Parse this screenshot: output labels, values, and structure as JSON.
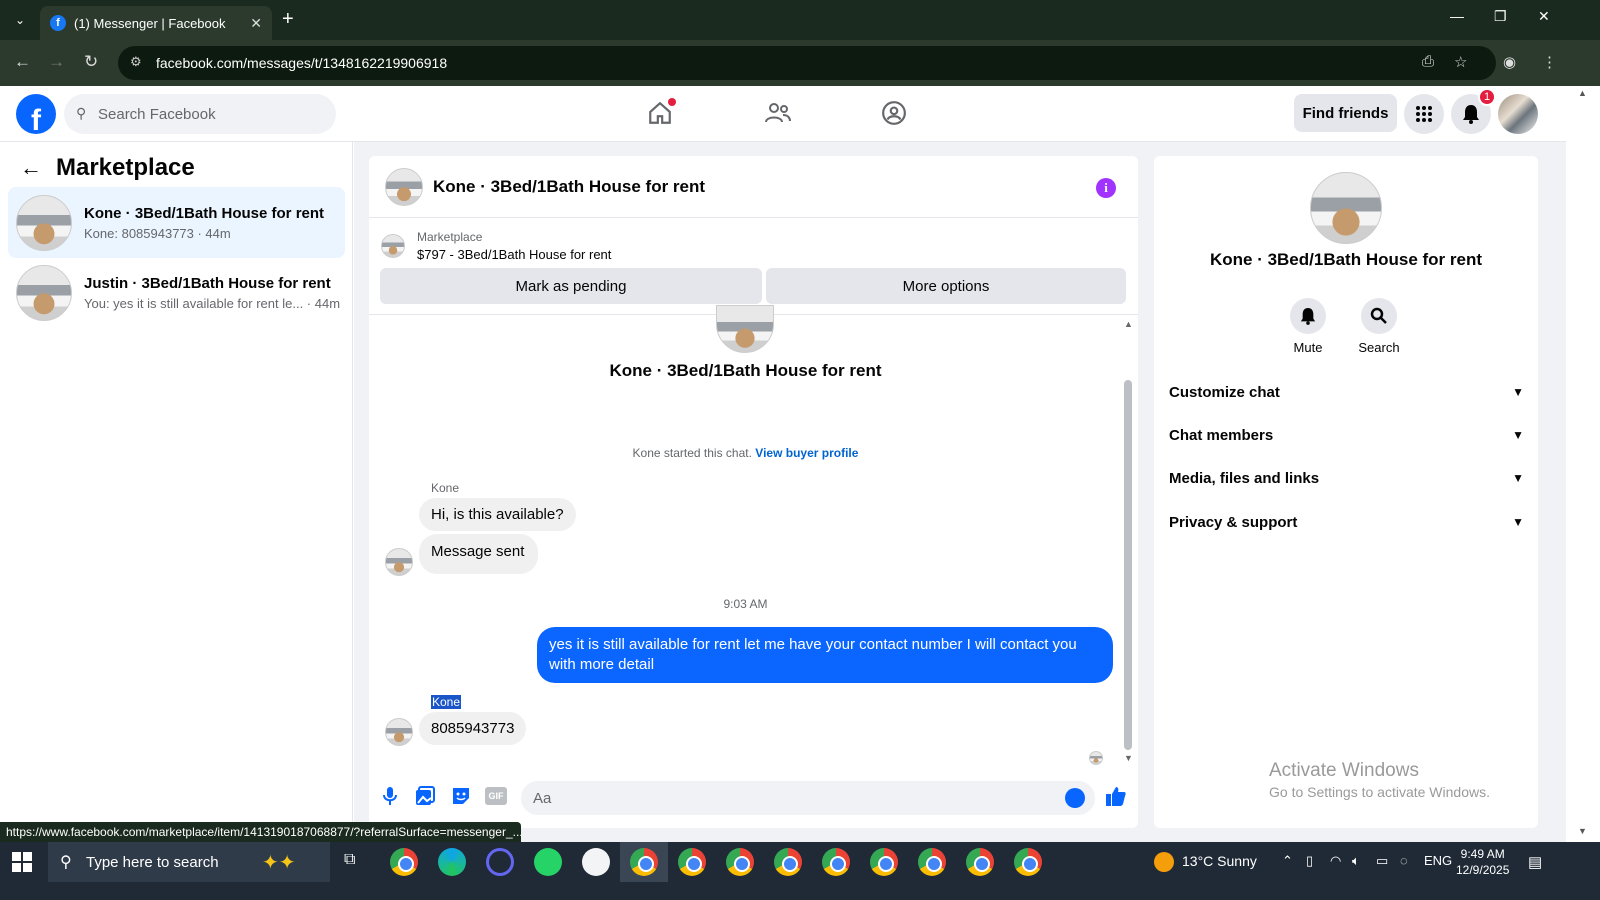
{
  "browser": {
    "tab_title": "(1) Messenger | Facebook",
    "url": "facebook.com/messages/t/1348162219906918",
    "status_url": "https://www.facebook.com/marketplace/item/1413190187068877/?referralSurface=messenger_..."
  },
  "fbnav": {
    "search_placeholder": "Search Facebook",
    "find_friends": "Find friends",
    "notification_count": "1"
  },
  "sidebar": {
    "title": "Marketplace",
    "conversations": [
      {
        "title": "Kone · 3Bed/1Bath House for rent",
        "snippet": "Kone: 8085943773 · 44m",
        "active": true
      },
      {
        "title": "Justin · 3Bed/1Bath House for rent",
        "snippet": "You: yes it is still available for rent le... · 44m",
        "active": false
      }
    ]
  },
  "chat": {
    "title": "Kone · 3Bed/1Bath House for rent",
    "marketplace_label": "Marketplace",
    "listing": "$797 - 3Bed/1Bath House for rent",
    "mark_pending": "Mark as pending",
    "more_options": "More options",
    "center_name": "Kone · 3Bed/1Bath House for rent",
    "started_text": "Kone started this chat.",
    "view_buyer_profile": "View buyer profile",
    "messages": [
      {
        "sender": "Kone",
        "text": "Hi, is this available?"
      },
      {
        "text": "Message sent"
      },
      {
        "time": "9:03 AM"
      },
      {
        "from_me": true,
        "text": "yes it is still available for rent let me have your contact number I will contact you with more detail"
      },
      {
        "sender": "Kone",
        "text": "8085943773"
      }
    ],
    "composer_placeholder": "Aa"
  },
  "details": {
    "name": "Kone · 3Bed/1Bath House for rent",
    "mute": "Mute",
    "search": "Search",
    "sections": [
      "Customize chat",
      "Chat members",
      "Media, files and links",
      "Privacy & support"
    ]
  },
  "watermark": {
    "line1": "Activate Windows",
    "line2": "Go to Settings to activate Windows."
  },
  "taskbar": {
    "search_placeholder": "Type here to search",
    "weather": "13°C  Sunny",
    "lang": "ENG",
    "time": "9:49 AM",
    "date": "12/9/2025"
  },
  "colors": {
    "brand": "#0866ff",
    "bubble_me": "#0a66ff",
    "info": "#a033ff"
  }
}
